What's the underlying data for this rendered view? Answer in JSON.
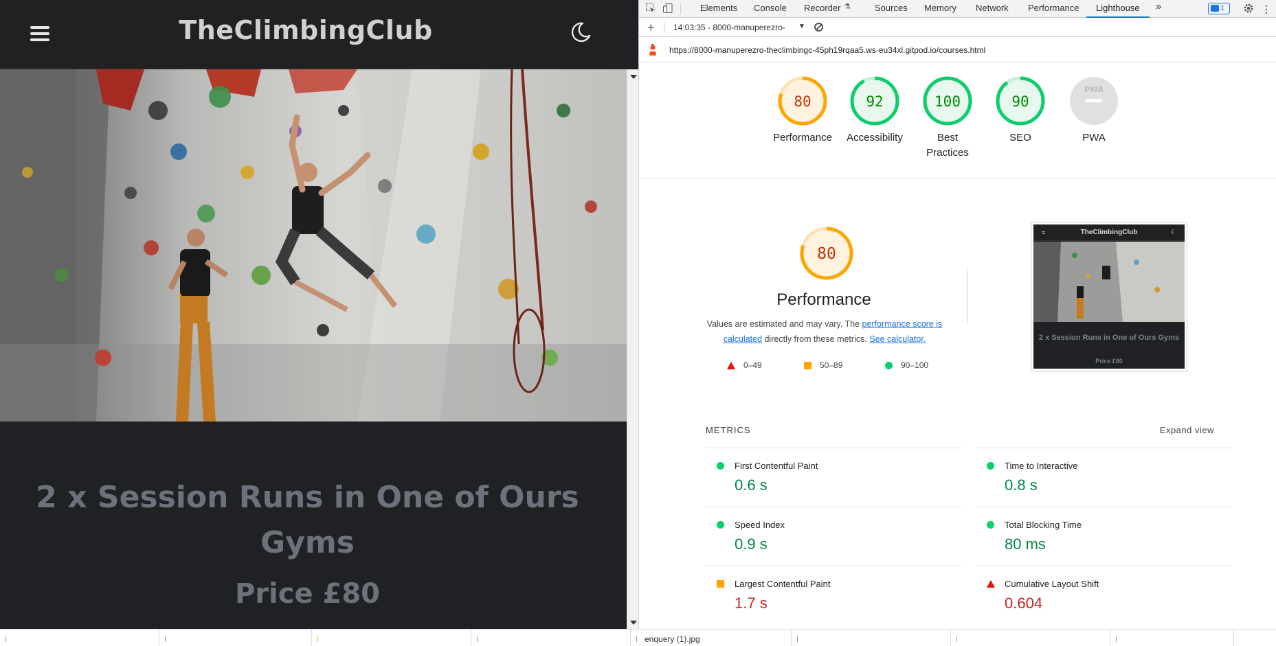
{
  "site": {
    "brand": "TheClimbingClub",
    "course_title": "2 x Session Runs in One of Ours Gyms",
    "price": "Price £80"
  },
  "devtools": {
    "tabs": [
      "Elements",
      "Console",
      "Recorder",
      "Sources",
      "Memory",
      "Network",
      "Performance",
      "Lighthouse"
    ],
    "active_tab": "Lighthouse",
    "more_tabs": "»",
    "issues_count": "1",
    "report_selector": "14:03:35 - 8000-manuperezro-",
    "url": "https://8000-manuperezro-theclimbingc-45ph19rqaa5.ws-eu34xl.gitpod.io/courses.html"
  },
  "gauges": [
    {
      "score": "80",
      "label": "Performance",
      "status": "average",
      "fraction": 0.8
    },
    {
      "score": "92",
      "label": "Accessibility",
      "status": "pass",
      "fraction": 0.92
    },
    {
      "score": "100",
      "label": "Best Practices",
      "status": "pass",
      "fraction": 1.0
    },
    {
      "score": "90",
      "label": "SEO",
      "status": "pass",
      "fraction": 0.9
    },
    {
      "score": "",
      "label": "PWA",
      "status": "na",
      "fraction": 0
    }
  ],
  "performance": {
    "score": "80",
    "title": "Performance",
    "desc_before": "Values are estimated and may vary. The ",
    "desc_link1": "performance score is calculated",
    "desc_middle": " directly from these metrics. ",
    "desc_link2": "See calculator.",
    "legend": [
      {
        "range": "0–49",
        "shape": "triangle",
        "color": "#eb0f00"
      },
      {
        "range": "50–89",
        "shape": "square",
        "color": "#ffa400"
      },
      {
        "range": "90–100",
        "shape": "circle",
        "color": "#0cce6b"
      }
    ],
    "thumbnail": {
      "brand": "TheClimbingClub",
      "title": "2 x Session Runs in One of Ours Gyms",
      "price": "Price £80"
    }
  },
  "metrics": {
    "heading": "METRICS",
    "expand": "Expand view",
    "items": [
      {
        "name": "First Contentful Paint",
        "value": "0.6 s",
        "status": "pass"
      },
      {
        "name": "Time to Interactive",
        "value": "0.8 s",
        "status": "pass"
      },
      {
        "name": "Speed Index",
        "value": "0.9 s",
        "status": "pass"
      },
      {
        "name": "Total Blocking Time",
        "value": "80 ms",
        "status": "pass"
      },
      {
        "name": "Largest Contentful Paint",
        "value": "1.7 s",
        "status": "average"
      },
      {
        "name": "Cumulative Layout Shift",
        "value": "0.604",
        "status": "fail"
      }
    ]
  },
  "bottombar": {
    "download_name": "enquery (1).jpg"
  },
  "colors": {
    "pass": "#0cce6b",
    "average": "#ffa400",
    "fail": "#eb0f00",
    "accent": "#1a73e8"
  }
}
